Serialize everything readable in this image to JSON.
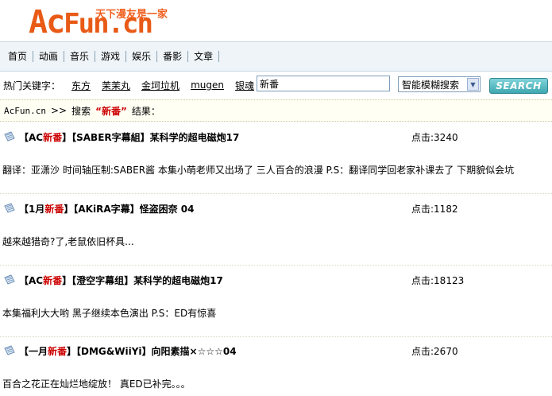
{
  "logo": {
    "word_part1": "Ac",
    "word_part2": "Fun.cn",
    "slogan": "天下漫友是一家"
  },
  "nav": {
    "items": [
      "首页",
      "动画",
      "音乐",
      "游戏",
      "娱乐",
      "番影",
      "文章"
    ]
  },
  "hot": {
    "label": "热门关键字：",
    "words": [
      "东方",
      "茉茉丸",
      "金坷垃机",
      "mugen",
      "银魂"
    ]
  },
  "search": {
    "value": "新番",
    "mode": "智能模糊搜索",
    "button": "SEARCH"
  },
  "breadcrumb": {
    "site": "AcFun.cn",
    "sep": ">>",
    "search": "搜索",
    "keyword": "“新番”",
    "result": "结果："
  },
  "results": [
    {
      "title_pre": "【AC",
      "title_hl": "新番",
      "title_post": "】【SABER字幕組】某科学的超电磁炮17",
      "hits": "点击:3240",
      "desc": "翻译：亚潇沙 时间轴压制:SABER酱 本集小萌老师又出场了 三人百合的浪漫 P.S：翻译同学回老家补课去了 下期貌似会坑"
    },
    {
      "title_pre": "【1月",
      "title_hl": "新番",
      "title_post": "】【AKiRA字幕】怪盗困奈 04",
      "hits": "点击:1182",
      "desc": "越来越猎奇?了,老鼠依旧杯具..."
    },
    {
      "title_pre": "【AC",
      "title_hl": "新番",
      "title_post": "】【澄空字幕组】某科学的超电磁炮17",
      "hits": "点击:18123",
      "desc": "本集福利大大哟 黑子继续本色演出 P.S：ED有惊喜"
    },
    {
      "title_pre": "【一月",
      "title_hl": "新番",
      "title_post": "】【DMG&WiiYi】向阳素描×☆☆☆04",
      "hits": "点击:2670",
      "desc": "百合之花正在灿烂地绽放！ 真ED已补完。。。"
    }
  ]
}
